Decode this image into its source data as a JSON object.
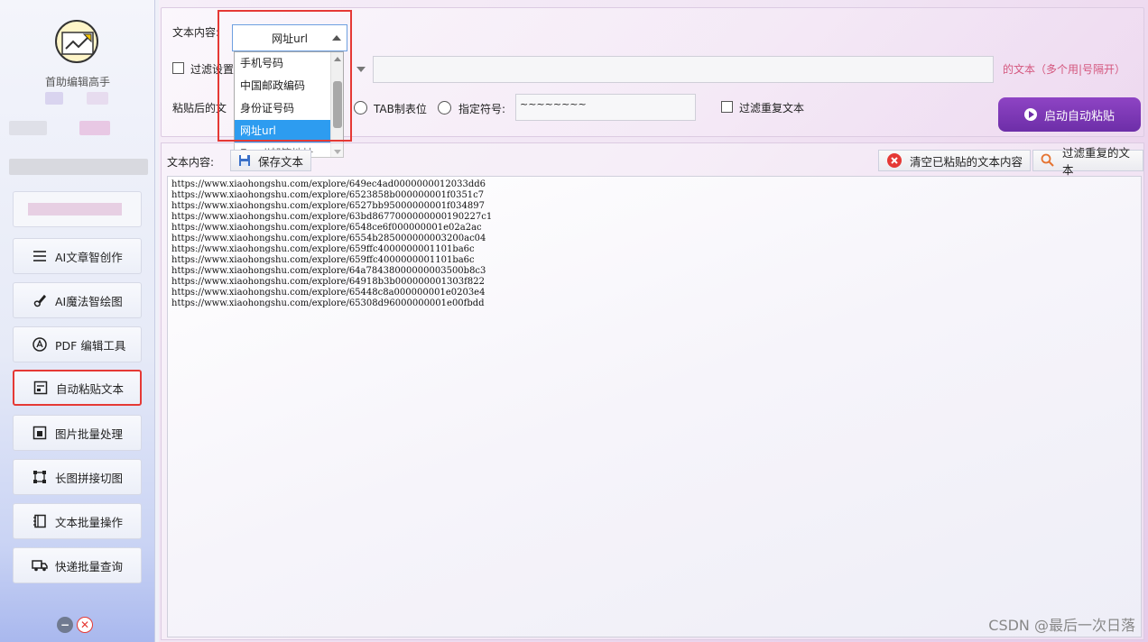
{
  "sidebar": {
    "app_name": "首助编辑高手",
    "items": [
      {
        "label": "AI文章智创作",
        "icon": "list-icon"
      },
      {
        "label": "AI魔法智绘图",
        "icon": "brush-icon"
      },
      {
        "label": "PDF 编辑工具",
        "icon": "pdf-icon"
      },
      {
        "label": "自动粘贴文本",
        "icon": "paste-icon"
      },
      {
        "label": "图片批量处理",
        "icon": "image-icon"
      },
      {
        "label": "长图拼接切图",
        "icon": "crop-icon"
      },
      {
        "label": "文本批量操作",
        "icon": "notebook-icon"
      },
      {
        "label": "快递批量查询",
        "icon": "truck-icon"
      }
    ]
  },
  "top": {
    "content_label": "文本内容:",
    "combo_value": "网址url",
    "filter_label": "过滤设置",
    "paste_after_label": "粘贴后的文",
    "filter_hint": "的文本（多个用|号隔开）",
    "tab_label": "TAB制表位",
    "custom_sep_label": "指定符号:",
    "custom_sep_value": "~~~~~~~~",
    "dedupe_label": "过滤重复文本",
    "start_button": "启动自动粘贴"
  },
  "dropdown": {
    "options": [
      "手机号码",
      "中国邮政编码",
      "身份证号码",
      "网址url",
      "Email邮箱地址"
    ],
    "selected": "网址url"
  },
  "bottom": {
    "content_label": "文本内容:",
    "save_button": "保存文本",
    "clear_button": "清空已粘贴的文本内容",
    "filter_dup_button": "过滤重复的文本",
    "lines": [
      "https://www.xiaohongshu.com/explore/649ec4ad0000000012033dd6",
      "https://www.xiaohongshu.com/explore/6523858b000000001f0351c7",
      "https://www.xiaohongshu.com/explore/6527bb95000000001f034897",
      "https://www.xiaohongshu.com/explore/63bd8677000000000190227c1",
      "https://www.xiaohongshu.com/explore/6548ce6f000000001e02a2ac",
      "https://www.xiaohongshu.com/explore/6554b285000000003200ac04",
      "https://www.xiaohongshu.com/explore/659ffc4000000001101ba6c",
      "https://www.xiaohongshu.com/explore/659ffc4000000001101ba6c",
      "https://www.xiaohongshu.com/explore/64a78438000000003500b8c3",
      "https://www.xiaohongshu.com/explore/64918b3b000000001303f822",
      "https://www.xiaohongshu.com/explore/65448c8a000000001e0203e4",
      "https://www.xiaohongshu.com/explore/65308d96000000001e00fbdd"
    ]
  },
  "watermark": "CSDN @最后一次日落",
  "colors": {
    "accent": "#6d2ea8",
    "highlight": "#e53935",
    "selection": "#2d9cf0"
  }
}
